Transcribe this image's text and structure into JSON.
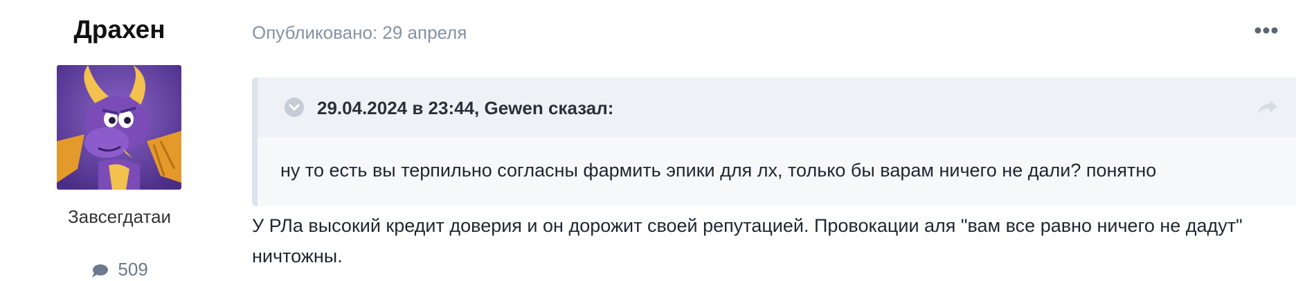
{
  "author": {
    "name": "Драхен",
    "group": "Завсегдатаи",
    "post_count": "509",
    "avatar_icon": "dragon-avatar-icon"
  },
  "post": {
    "published": "Опубликовано: 29 апреля",
    "quote": {
      "citation": "29.04.2024 в 23:44, Gewen сказал:",
      "text": "ну то есть вы терпильно согласны фармить эпики для лх, только бы варам ничего не дали? понятно"
    },
    "body": "У РЛа высокий кредит доверия и он дорожит своей репутацией. Провокации аля \"вам все равно ничего не дадут\" ничтожны."
  },
  "colors": {
    "muted": "#8491a3",
    "quote_bg": "#f7f8fa",
    "quote_header_bg": "#eef1f5",
    "quote_bar": "#dde3ec"
  }
}
